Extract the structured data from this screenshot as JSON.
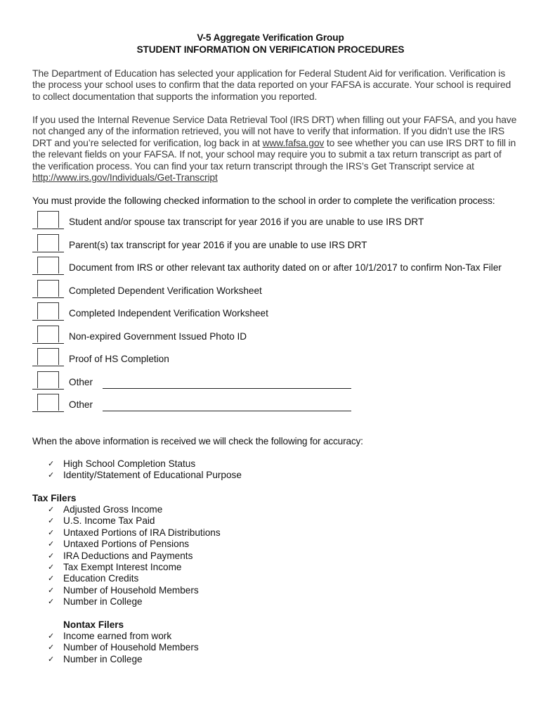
{
  "header": {
    "title_line1": "V-5 Aggregate Verification Group",
    "title_line2": "STUDENT INFORMATION ON VERIFICATION PROCEDURES"
  },
  "intro": {
    "paragraph1": "The Department of Education has selected your application for Federal Student Aid for verification. Verification is the process your school uses to confirm that the data reported on your FAFSA is accurate.  Your school is required to collect documentation that supports the information you reported.",
    "paragraph2_part1": "If you used the Internal Revenue Service Data Retrieval Tool (IRS DRT) when filling out your FAFSA, and you have not changed any of the information retrieved, you will not have to verify that information. If you didn’t use the IRS DRT and you’re selected for verification, log back in at ",
    "fafsa_link": "www.fafsa.gov",
    "paragraph2_part2": " to see whether you can use IRS DRT to fill in the relevant fields on your FAFSA. If not, your school may require you to submit a tax return transcript as part of the verification process. You can find your tax return transcript through the IRS’s Get Transcript service at ",
    "irs_link": "http://www.irs.gov/Individuals/Get-Transcript"
  },
  "checklist": {
    "lead": "You must provide the following checked information to the school in order to complete the verification process:",
    "items": [
      {
        "label": "Student and/or spouse tax transcript for year 2016 if you are unable to use IRS DRT",
        "checked": false
      },
      {
        "label": "Parent(s) tax transcript for year 2016 if you are unable to use IRS DRT",
        "checked": false
      },
      {
        "label": "Document from IRS or other relevant tax authority dated on or after 10/1/2017 to confirm Non-Tax Filer",
        "checked": false
      },
      {
        "label": "Completed Dependent Verification Worksheet",
        "checked": false
      },
      {
        "label": "Completed Independent Verification Worksheet",
        "checked": false
      },
      {
        "label": "Non-expired Government Issued Photo ID",
        "checked": false
      },
      {
        "label": "Proof of HS Completion",
        "checked": false
      },
      {
        "label": "Other",
        "checked": false,
        "value": ""
      },
      {
        "label": "Other",
        "checked": false,
        "value": ""
      }
    ]
  },
  "accuracy": {
    "lead": "When the above information is received we will check the following for accuracy:",
    "check_glyph": "✓",
    "general": [
      "High School Completion Status",
      "Identity/Statement of Educational Purpose"
    ],
    "tax_filers_heading": "Tax Filers",
    "tax_filers": [
      "Adjusted Gross Income",
      "U.S. Income Tax Paid",
      "Untaxed Portions of IRA Distributions",
      "Untaxed Portions of Pensions",
      "IRA Deductions and Payments",
      "Tax Exempt Interest Income",
      "Education Credits",
      "Number of Household Members",
      "Number in College"
    ],
    "nontax_filers_heading": "Nontax Filers",
    "nontax_filers": [
      "Income earned from work",
      "Number of Household Members",
      "Number in College"
    ]
  }
}
